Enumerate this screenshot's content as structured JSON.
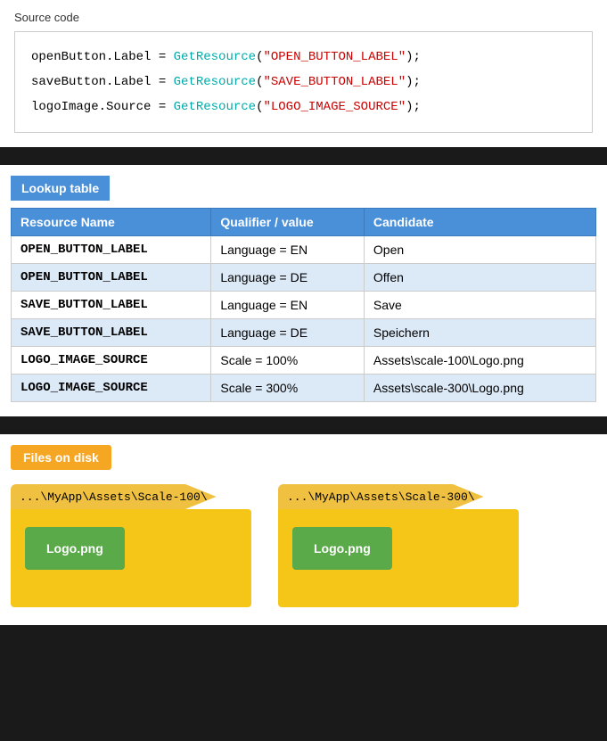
{
  "sourceCode": {
    "sectionLabel": "Source code",
    "lines": [
      {
        "var": "openButton.Label",
        "equals": " = ",
        "func": "GetResource",
        "string": "\"OPEN_BUTTON_LABEL\"",
        "semi": ";"
      },
      {
        "var": "saveButton.Label",
        "equals": " = ",
        "func": "GetResource",
        "string": "\"SAVE_BUTTON_LABEL\"",
        "semi": ";"
      },
      {
        "var": "logoImage.Source",
        "equals": " = ",
        "func": "GetResource",
        "string": "\"LOGO_IMAGE_SOURCE\"",
        "semi": ";"
      }
    ]
  },
  "lookupTable": {
    "headerLabel": "Lookup table",
    "columns": [
      "Resource Name",
      "Qualifier / value",
      "Candidate"
    ],
    "rows": [
      {
        "resource": "OPEN_BUTTON_LABEL",
        "qualifier": "Language = EN",
        "candidate": "Open"
      },
      {
        "resource": "OPEN_BUTTON_LABEL",
        "qualifier": "Language = DE",
        "candidate": "Offen"
      },
      {
        "resource": "SAVE_BUTTON_LABEL",
        "qualifier": "Language = EN",
        "candidate": "Save"
      },
      {
        "resource": "SAVE_BUTTON_LABEL",
        "qualifier": "Language = DE",
        "candidate": "Speichern"
      },
      {
        "resource": "LOGO_IMAGE_SOURCE",
        "qualifier": "Scale = 100%",
        "candidate": "Assets\\scale-100\\Logo.png"
      },
      {
        "resource": "LOGO_IMAGE_SOURCE",
        "qualifier": "Scale = 300%",
        "candidate": "Assets\\scale-300\\Logo.png"
      }
    ]
  },
  "filesOnDisk": {
    "headerLabel": "Files on disk",
    "folders": [
      {
        "path": "...\\MyApp\\Assets\\Scale-100\\",
        "file": "Logo.png"
      },
      {
        "path": "...\\MyApp\\Assets\\Scale-300\\",
        "file": "Logo.png"
      }
    ]
  }
}
